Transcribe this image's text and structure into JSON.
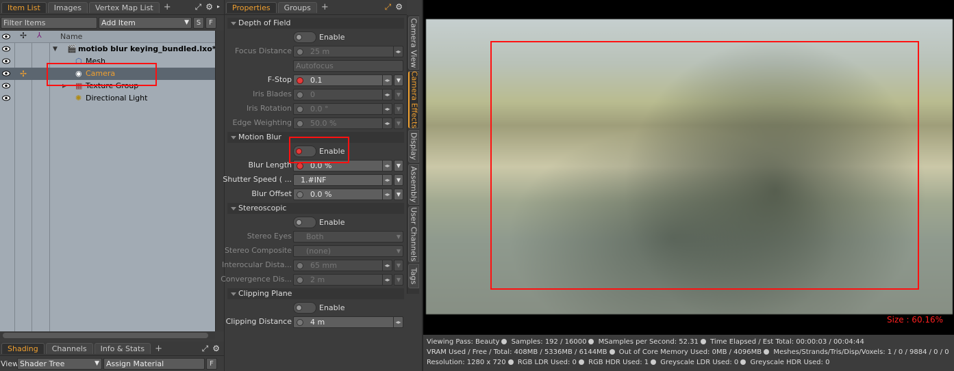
{
  "left": {
    "tabs": [
      "Item List",
      "Images",
      "Vertex Map List"
    ],
    "active_tab": "Item List",
    "filter_placeholder": "Filter Items",
    "add_item": "Add Item",
    "s_label": "S",
    "f_label": "F",
    "name_header": "Name",
    "tree": [
      {
        "label": "motiob blur keying_bundled.lxo*",
        "icon": "scene-icon"
      },
      {
        "label": "Mesh",
        "icon": "mesh-icon"
      },
      {
        "label": "Camera",
        "icon": "camera-icon",
        "selected": true
      },
      {
        "label": "Texture Group",
        "icon": "texture-group-icon"
      },
      {
        "label": "Directional Light",
        "icon": "light-icon"
      }
    ],
    "bottom_tabs": [
      "Shading",
      "Channels",
      "Info & Stats"
    ],
    "bottom_active": "Shading",
    "view_label": "View",
    "shader_tree": "Shader Tree",
    "assign_material": "Assign Material",
    "bottom_f": "F"
  },
  "mid": {
    "tabs": [
      "Properties",
      "Groups"
    ],
    "active_tab": "Properties",
    "sections": {
      "dof": "Depth of Field",
      "motion": "Motion Blur",
      "stereo": "Stereoscopic",
      "clip": "Clipping Plane"
    },
    "enable": "Enable",
    "focus_distance": {
      "label": "Focus Distance",
      "value": "25 m"
    },
    "autofocus": "Autofocus",
    "fstop": {
      "label": "F-Stop",
      "value": "0.1"
    },
    "iris_blades": {
      "label": "Iris Blades",
      "value": "0"
    },
    "iris_rotation": {
      "label": "Iris Rotation",
      "value": "0.0 °"
    },
    "edge_weighting": {
      "label": "Edge Weighting",
      "value": "50.0 %"
    },
    "blur_length": {
      "label": "Blur Length",
      "value": "0.0 %"
    },
    "shutter_speed": {
      "label": "Shutter Speed ( ...",
      "value": "1.#INF"
    },
    "blur_offset": {
      "label": "Blur Offset",
      "value": "0.0 %"
    },
    "stereo_eyes": {
      "label": "Stereo Eyes",
      "value": "Both"
    },
    "stereo_composite": {
      "label": "Stereo Composite",
      "value": "(none)"
    },
    "interocular": {
      "label": "Interocular Dista...",
      "value": "65 mm"
    },
    "convergence": {
      "label": "Convergence Dis...",
      "value": "2 m"
    },
    "clipping_distance": {
      "label": "Clipping Distance",
      "value": "4 m"
    },
    "vertical_tabs": [
      "Camera View",
      "Camera Effects",
      "Display",
      "Assembly",
      "User Channels",
      "Tags"
    ],
    "vertical_active": "Camera Effects"
  },
  "viewport": {
    "size_label": "Size : 60.16%",
    "status": {
      "viewing_pass": "Viewing Pass: Beauty",
      "samples": "Samples: 192  / 16000",
      "msamples": "MSamples per Second: 52.31",
      "time": "Time Elapsed / Est Total: 00:00:03 / 00:04:44",
      "vram": "VRAM Used / Free / Total: 408MB / 5336MB / 6144MB",
      "ooc": "Out of Core Memory Used: 0MB / 4096MB",
      "meshes": "Meshes/Strands/Tris/Disp/Voxels: 1 / 0 / 9884 / 0 / 0",
      "resolution": "Resolution: 1280 x 720",
      "rgb_ldr": "RGB LDR Used: 0",
      "rgb_hdr": "RGB HDR Used: 1",
      "grey_ldr": "Greyscale LDR Used: 0",
      "grey_hdr": "Greyscale HDR Used: 0"
    }
  },
  "colors": {
    "accent": "#f0a030",
    "annotation": "#ff1010",
    "enabled_dot": "#e53b3b"
  }
}
